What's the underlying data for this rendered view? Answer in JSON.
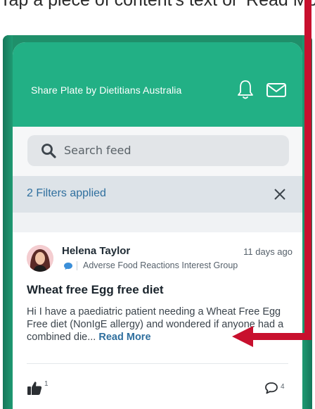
{
  "caption": "Tap a piece of content's text or 'Read More'",
  "app": {
    "title": "Share Plate by Dietitians Australia",
    "header_color": "#22b085",
    "icons": {
      "notifications": "bell-icon",
      "messages": "mail-icon"
    }
  },
  "search": {
    "placeholder": "Search feed",
    "icon": "search-icon"
  },
  "filters": {
    "label": "2 Filters applied",
    "clear_icon": "close-icon"
  },
  "post": {
    "author": "Helena Taylor",
    "time": "11 days ago",
    "group": "Adverse Food Reactions Interest Group",
    "title": "Wheat free Egg free diet",
    "body": "Hi I have a paediatric patient needing a Wheat Free Egg Free diet (NonIgE allergy) and wondered if anyone had a combined die...",
    "read_more": "Read More",
    "likes": "1",
    "comments": "4"
  },
  "annotation": {
    "arrow_color": "#c8102e"
  }
}
